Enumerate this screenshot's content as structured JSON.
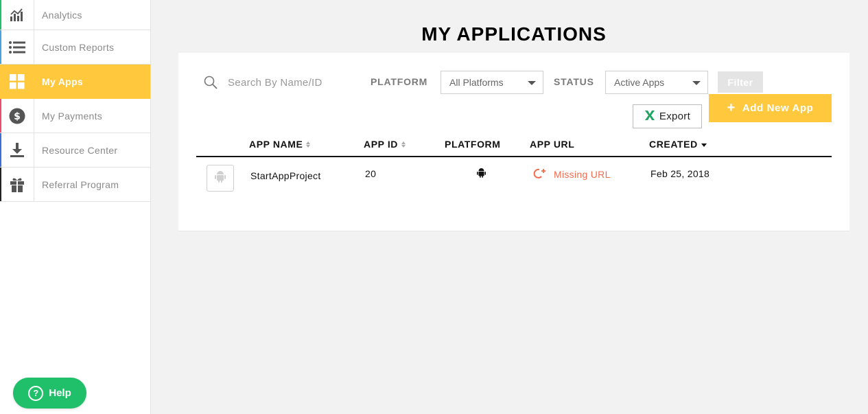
{
  "sidebar": {
    "items": [
      {
        "label": "Analytics",
        "icon": "analytics-chart-icon",
        "accent": "#21c06a",
        "active": false
      },
      {
        "label": "Custom Reports",
        "icon": "list-icon",
        "accent": "#4aa3df",
        "active": false
      },
      {
        "label": "My Apps",
        "icon": "apps-grid-icon",
        "accent": "#ffc83d",
        "active": true
      },
      {
        "label": "My Payments",
        "icon": "dollar-icon",
        "accent": "#e84c6a",
        "active": false
      },
      {
        "label": "Resource Center",
        "icon": "download-icon",
        "accent": "#3b6fd4",
        "active": false
      },
      {
        "label": "Referral Program",
        "icon": "gift-icon",
        "accent": "#222222",
        "active": false
      }
    ],
    "help_label": "Help"
  },
  "main": {
    "title": "MY APPLICATIONS",
    "search": {
      "placeholder": "Search By Name/ID",
      "value": ""
    },
    "platform_filter": {
      "label": "PLATFORM",
      "selected": "All Platforms"
    },
    "status_filter": {
      "label": "STATUS",
      "selected": "Active Apps"
    },
    "filter_button": "Filter",
    "export_button": "Export",
    "add_button": "Add New App",
    "table": {
      "columns": [
        "APP NAME",
        "APP ID",
        "PLATFORM",
        "APP URL",
        "CREATED"
      ],
      "rows": [
        {
          "name": "StartAppProject",
          "id": "20",
          "platform": "android",
          "url": "Missing URL",
          "created": "Feb 25, 2018"
        }
      ]
    }
  },
  "colors": {
    "accent_yellow": "#ffc83d",
    "help_green": "#20c06a",
    "missing_url_red": "#f26b4d",
    "excel_green": "#1fa463"
  }
}
